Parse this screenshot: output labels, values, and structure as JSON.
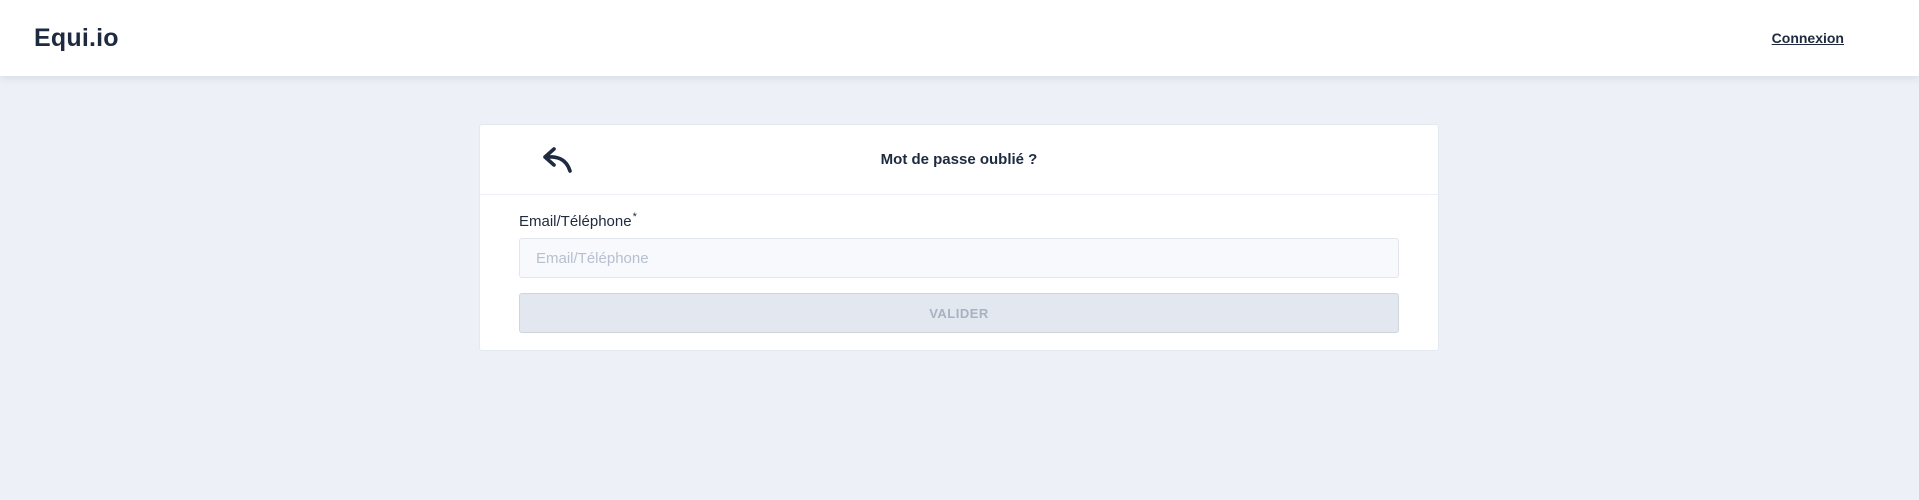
{
  "header": {
    "brand": "Equi.io",
    "login_link": "Connexion"
  },
  "card": {
    "back_icon": "reply-arrow-icon",
    "title": "Mot de passe oublié ?",
    "field": {
      "label": "Email/Téléphone",
      "required_marker": "*",
      "value": "",
      "placeholder": "Email/Téléphone"
    },
    "submit_label": "VALIDER"
  }
}
